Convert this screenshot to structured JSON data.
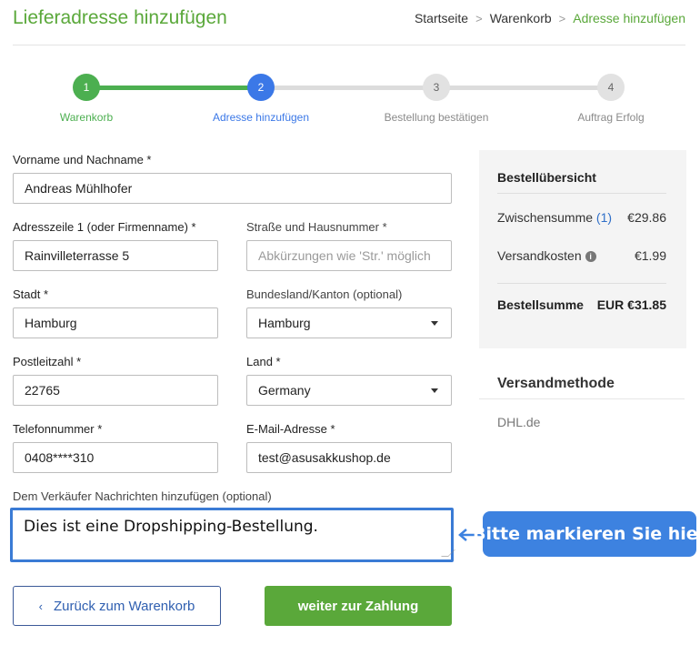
{
  "header": {
    "title": "Lieferadresse hinzufügen",
    "breadcrumb": [
      "Startseite",
      "Warenkorb",
      "Adresse hinzufügen"
    ],
    "separator": ">"
  },
  "stepper": {
    "steps": [
      {
        "number": "1",
        "label": "Warenkorb",
        "state": "done"
      },
      {
        "number": "2",
        "label": "Adresse hinzufügen",
        "state": "current"
      },
      {
        "number": "3",
        "label": "Bestellung bestätigen",
        "state": "todo"
      },
      {
        "number": "4",
        "label": "Auftrag Erfolg",
        "state": "todo"
      }
    ]
  },
  "form": {
    "name": {
      "label": "Vorname und Nachname *",
      "value": "Andreas Mühlhofer"
    },
    "address1": {
      "label": "Adresszeile 1 (oder Firmenname) *",
      "value": "Rainvilleterrasse 5"
    },
    "street": {
      "label": "Straße und Hausnummer *",
      "value": "",
      "placeholder": "Abkürzungen wie 'Str.' möglich"
    },
    "city": {
      "label": "Stadt *",
      "value": "Hamburg"
    },
    "state": {
      "label": "Bundesland/Kanton (optional)",
      "value": "Hamburg"
    },
    "zip": {
      "label": "Postleitzahl *",
      "value": "22765"
    },
    "country": {
      "label": "Land *",
      "value": "Germany"
    },
    "phone": {
      "label": "Telefonnummer *",
      "value": "0408****310"
    },
    "email": {
      "label": "E-Mail-Adresse *",
      "value": "test@asusakkushop.de"
    },
    "message": {
      "label": "Dem Verkäufer Nachrichten hinzufügen (optional)",
      "value": "Dies ist eine Dropshipping-Bestellung."
    }
  },
  "callout": {
    "text": "Bitte markieren Sie hier"
  },
  "buttons": {
    "back_icon": "‹",
    "back_label": "Zurück zum Warenkorb",
    "pay_label": "weiter zur Zahlung"
  },
  "summary": {
    "title": "Bestellübersicht",
    "subtotal_label": "Zwischensumme",
    "subtotal_count": "(1)",
    "subtotal_value": "€29.86",
    "shipping_label": "Versandkosten",
    "shipping_info_glyph": "i",
    "shipping_value": "€1.99",
    "total_label": "Bestellsumme",
    "total_value": "EUR €31.85"
  },
  "shipping_method": {
    "title": "Versandmethode",
    "value": "DHL.de"
  },
  "colors": {
    "accent_green": "#5aa83a",
    "step_blue": "#3b78e7",
    "highlight_blue": "#3a7bd5"
  }
}
